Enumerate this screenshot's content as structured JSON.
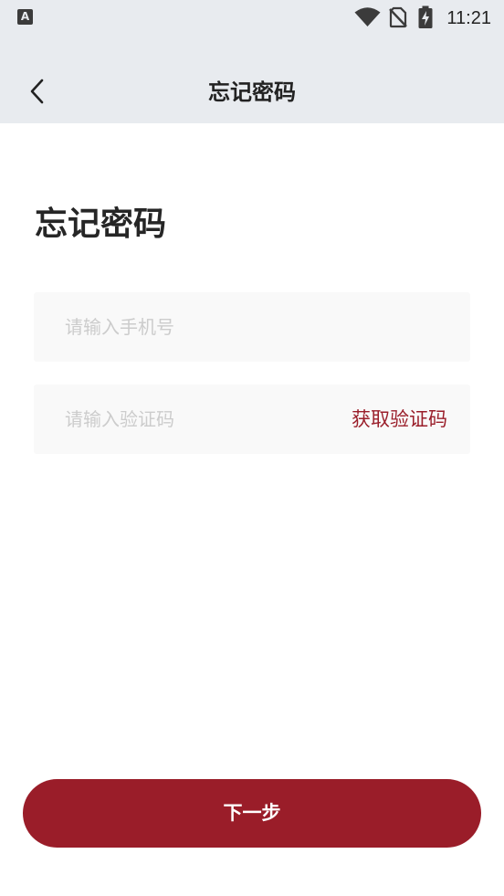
{
  "status_bar": {
    "left_icon_label": "A",
    "time": "11:21",
    "icons": [
      "app-notification-icon",
      "wifi-icon",
      "no-sim-icon",
      "battery-charging-icon"
    ]
  },
  "header": {
    "back_icon": "chevron-left-icon",
    "title": "忘记密码"
  },
  "page": {
    "heading": "忘记密码"
  },
  "phone_field": {
    "placeholder": "请输入手机号",
    "value": ""
  },
  "code_field": {
    "placeholder": "请输入验证码",
    "value": "",
    "get_code_label": "获取验证码"
  },
  "next_button": {
    "label": "下一步"
  },
  "colors": {
    "header_background": "#e8ebef",
    "accent": "#9a1d29",
    "field_background": "#f9f9f9",
    "placeholder": "#cccccc",
    "text": "#222222"
  }
}
